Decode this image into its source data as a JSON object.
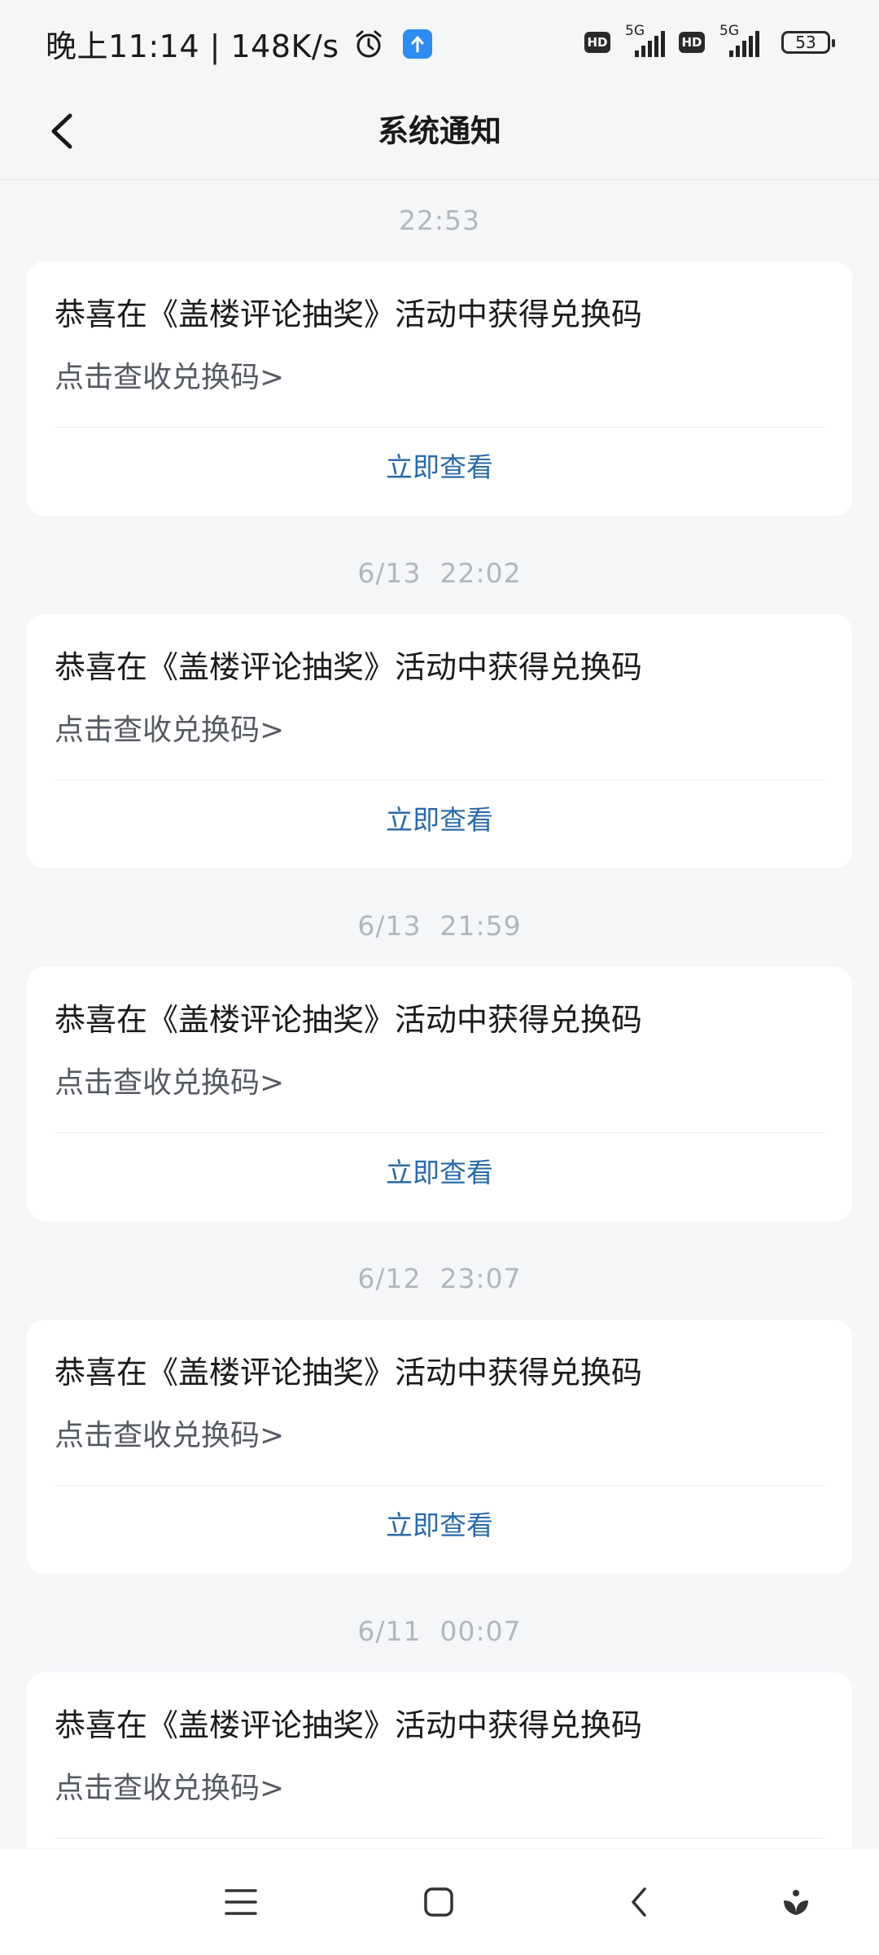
{
  "status_bar": {
    "time_text": "晚上11:14 | 148K/s",
    "network_label_1": "5G",
    "network_label_2": "5G",
    "hd_label": "HD",
    "battery_level": "53"
  },
  "header": {
    "title": "系统通知"
  },
  "notifications": [
    {
      "timestamp": "22:53",
      "title": "恭喜在《盖楼评论抽奖》活动中获得兑换码",
      "subtitle": "点击查收兑换码>",
      "action": "立即查看"
    },
    {
      "timestamp": "6/13  22:02",
      "title": "恭喜在《盖楼评论抽奖》活动中获得兑换码",
      "subtitle": "点击查收兑换码>",
      "action": "立即查看"
    },
    {
      "timestamp": "6/13  21:59",
      "title": "恭喜在《盖楼评论抽奖》活动中获得兑换码",
      "subtitle": "点击查收兑换码>",
      "action": "立即查看"
    },
    {
      "timestamp": "6/12  23:07",
      "title": "恭喜在《盖楼评论抽奖》活动中获得兑换码",
      "subtitle": "点击查收兑换码>",
      "action": "立即查看"
    },
    {
      "timestamp": "6/11  00:07",
      "title": "恭喜在《盖楼评论抽奖》活动中获得兑换码",
      "subtitle": "点击查收兑换码>",
      "action": ""
    }
  ],
  "colors": {
    "background": "#f5f6f8",
    "card": "#ffffff",
    "action_link": "#2a6aa8",
    "timestamp": "#b3b6bc"
  },
  "icons": [
    "back-arrow-icon",
    "alarm-clock-icon",
    "upload-app-icon",
    "hd-icon",
    "signal-icon",
    "battery-icon",
    "menu-icon",
    "home-square-icon",
    "nav-back-icon",
    "assistant-icon"
  ]
}
